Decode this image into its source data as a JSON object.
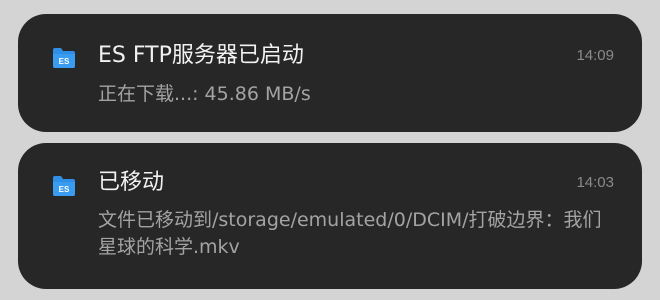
{
  "notifications": [
    {
      "app_icon": "folder-icon",
      "icon_text": "ES",
      "title": "ES FTP服务器已启动",
      "time": "14:09",
      "body": "正在下载...: 45.86 MB/s"
    },
    {
      "app_icon": "folder-icon",
      "icon_text": "ES",
      "title": "已移动",
      "time": "14:03",
      "body": "文件已移动到/storage/emulated/0/DCIM/打破边界：我们星球的科学.mkv"
    }
  ],
  "colors": {
    "background": "#d4d4d4",
    "card": "#272727",
    "icon_blue": "#2f8fe4",
    "title": "#f2f2f2",
    "body": "#a3a3a3",
    "time": "#8a8a8a"
  }
}
